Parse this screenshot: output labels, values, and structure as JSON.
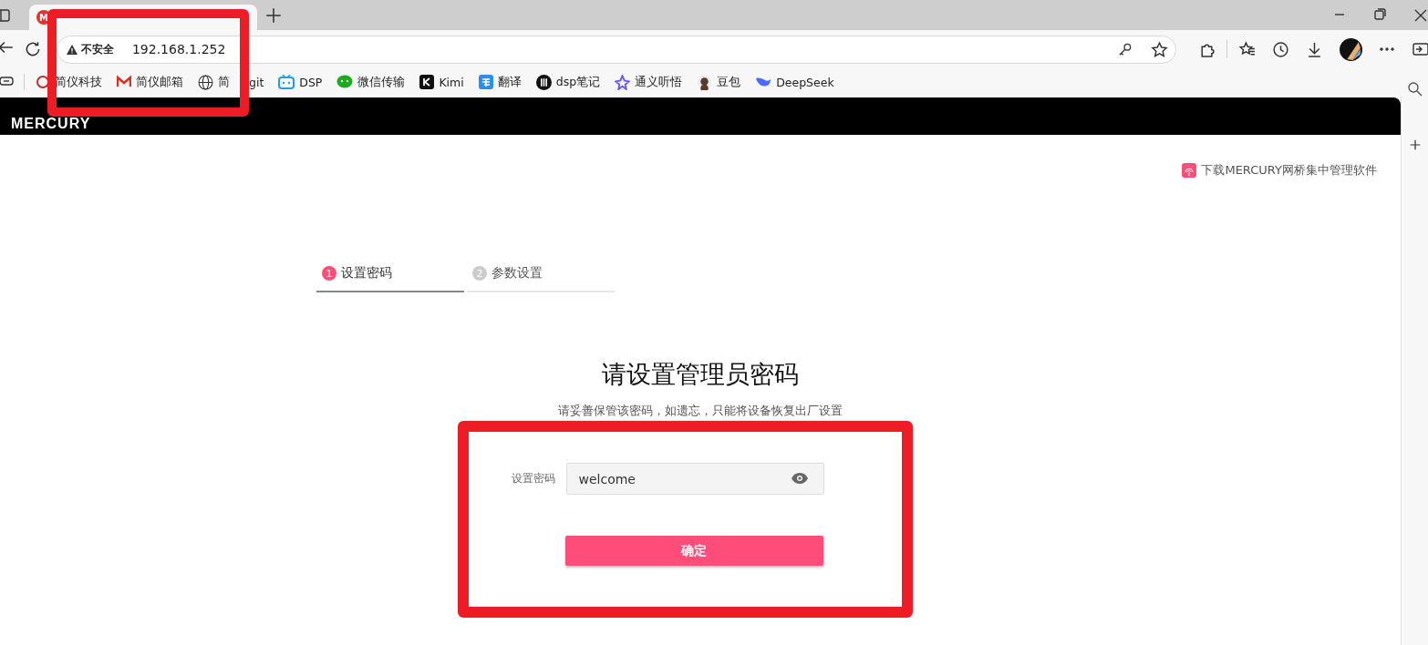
{
  "browser": {
    "tab": {
      "favicon": "M"
    },
    "address": {
      "security": "不安全",
      "url": "192.168.1.252"
    },
    "bookmarks": [
      {
        "label": "简仪科技"
      },
      {
        "label": "简仪邮箱"
      },
      {
        "label": "简",
        "label_tail": "git"
      },
      {
        "label": "DSP"
      },
      {
        "label": "微信传输"
      },
      {
        "label": "Kimi"
      },
      {
        "label": "翻译"
      },
      {
        "label": "dsp笔记"
      },
      {
        "label": "通义听悟"
      },
      {
        "label": "豆包"
      },
      {
        "label": "DeepSeek"
      }
    ]
  },
  "header": {
    "logo": "MERCURY"
  },
  "download_link": "下载MERCURY网桥集中管理软件",
  "steps": [
    {
      "number": "1",
      "label": "设置密码",
      "selected": true
    },
    {
      "number": "2",
      "label": "参数设置",
      "selected": false
    }
  ],
  "title": "请设置管理员密码",
  "subtitle": "请妥善保管该密码，如遗忘，只能将设备恢复出厂设置",
  "form": {
    "label": "设置密码",
    "value": "welcome"
  },
  "submit_button": "确定"
}
